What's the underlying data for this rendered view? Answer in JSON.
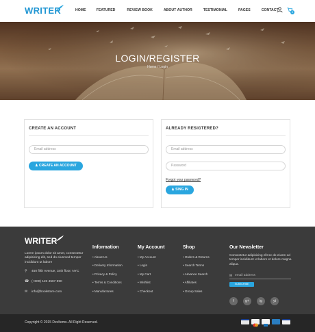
{
  "brand": {
    "logo": "WRITER",
    "accent": "#2aa6df"
  },
  "nav": {
    "items": [
      "HOME",
      "FEATURED",
      "REVIEW BOOK",
      "ABOUT AUTHOR",
      "TESTIMONIAL",
      "PAGES",
      "CONTACT"
    ],
    "cart_count": "0"
  },
  "hero": {
    "title": "LOGIN/REGISTER",
    "breadcrumb": "Home / Login"
  },
  "create": {
    "title": "CREATE AN ACCOUNT",
    "email_placeholder": "Email address",
    "button": "CREATE AN ACCOUNT"
  },
  "login": {
    "title": "ALREADY RESIGTERED?",
    "email_placeholder": "Email address",
    "password_placeholder": "Password",
    "forgot": "Forgot your password?",
    "button": "SING IN"
  },
  "footer": {
    "logo": "WRITER",
    "about": "Lorem ipsum dolor sit amet, consectetur adipisicing elit, sed do eiusmod tempor incididunt ut labore",
    "address": "450 fifth Avenue, 34th floor. NYC",
    "phone": "(+800) 123 4567 890",
    "email": "info@bookstore.com",
    "info": {
      "title": "Information",
      "items": [
        "About Us",
        "Delivery Information",
        "Privacy & Policy",
        "Terms & Conditions",
        "Manufactures"
      ]
    },
    "account": {
      "title": "My Account",
      "items": [
        "My Account",
        "Login",
        "My Cart",
        "Wishlist",
        "Checkout"
      ]
    },
    "shop": {
      "title": "Shop",
      "items": [
        "Orders & Returns",
        "Search Terms",
        "Advance Search",
        "Affiliates",
        "Group Sales"
      ]
    },
    "newsletter": {
      "title": "Our Newsletter",
      "text": "Consectetur adipisicing elit se do eiusm od tempor incididunt ut labore et dolore magna aliqua.",
      "placeholder": "email address",
      "button": "SUBSCRIBE"
    },
    "socials": [
      "f",
      "g+",
      "ig",
      "yt"
    ],
    "copyright": "Copyright © 2015 DevItems. All Right Reserved."
  }
}
